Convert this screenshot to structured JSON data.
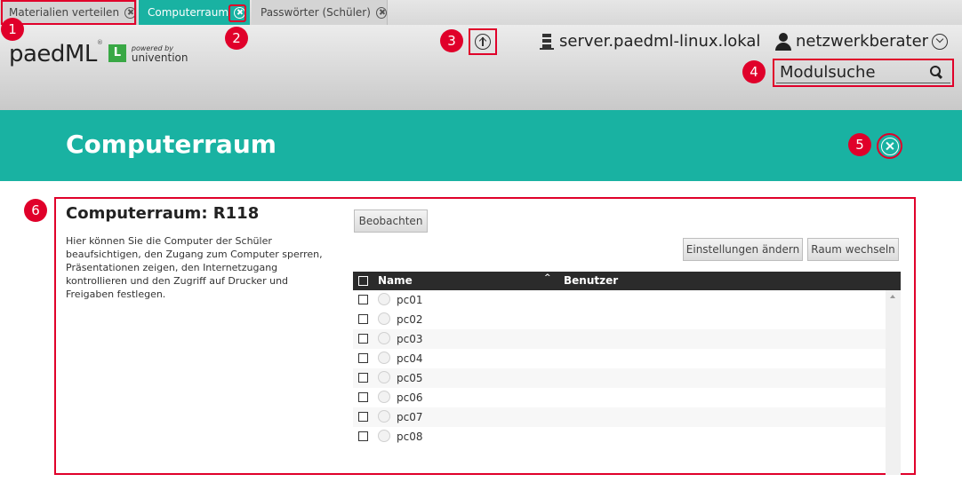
{
  "tabs": [
    {
      "label": "Materialien verteilen",
      "active": false
    },
    {
      "label": "Computerraum",
      "active": true
    },
    {
      "label": "Passwörter (Schüler)",
      "active": false
    }
  ],
  "header": {
    "logo": {
      "name": "paedML",
      "edition": "L",
      "powered_by": "powered by",
      "vendor": "univention"
    },
    "server": "server.paedml-linux.lokal",
    "user": "netzwerkberater",
    "search": {
      "placeholder": "Modulsuche",
      "value": ""
    }
  },
  "module": {
    "title": "Computerraum"
  },
  "room": {
    "title": "Computerraum: R118",
    "description": "Hier können Sie die Computer der Schüler beaufsichtigen, den Zugang zum Computer sperren, Präsentationen zeigen, den Internetzugang kontrollieren und den Zugriff auf Drucker und Freigaben festlegen."
  },
  "buttons": {
    "observe": "Beobachten",
    "settings": "Einstellungen ändern",
    "switch_room": "Raum wechseln"
  },
  "grid": {
    "columns": [
      "Name",
      "Benutzer"
    ],
    "rows": [
      {
        "name": "pc01",
        "user": ""
      },
      {
        "name": "pc02",
        "user": ""
      },
      {
        "name": "pc03",
        "user": ""
      },
      {
        "name": "pc04",
        "user": ""
      },
      {
        "name": "pc05",
        "user": ""
      },
      {
        "name": "pc06",
        "user": ""
      },
      {
        "name": "pc07",
        "user": ""
      },
      {
        "name": "pc08",
        "user": ""
      }
    ]
  },
  "markers": [
    "1",
    "2",
    "3",
    "4",
    "5",
    "6"
  ],
  "colors": {
    "accent": "#19b2a2",
    "highlight": "#e0002a",
    "grid_header": "#2b2b2b"
  }
}
